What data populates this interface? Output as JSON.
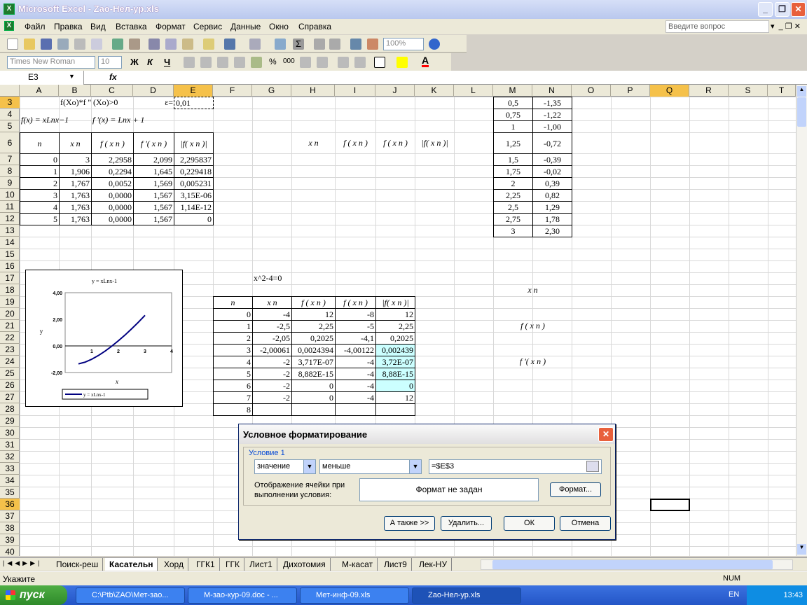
{
  "app": {
    "title": "Microsoft Excel - Zao-Нел-ур.xls",
    "icon": "excel-icon"
  },
  "menu": [
    "Файл",
    "Правка",
    "Вид",
    "Вставка",
    "Формат",
    "Сервис",
    "Данные",
    "Окно",
    "Справка"
  ],
  "ask_placeholder": "Введите вопрос",
  "toolbar": {
    "zoom": "100%",
    "font": "Times New Roman",
    "size": "10",
    "bold": "Ж",
    "italic": "К",
    "underline": "Ч",
    "percent": "%",
    "thousands": "000"
  },
  "namebox": "E3",
  "fx": "fx",
  "columns": [
    "A",
    "B",
    "C",
    "D",
    "E",
    "F",
    "G",
    "H",
    "I",
    "J",
    "K",
    "L",
    "M",
    "N",
    "O",
    "P",
    "Q",
    "R",
    "S",
    "T"
  ],
  "rows": [
    "3",
    "4",
    "5",
    "6",
    "7",
    "8",
    "9",
    "10",
    "11",
    "12",
    "13",
    "14",
    "15",
    "16",
    "17",
    "18",
    "19",
    "20",
    "21",
    "22",
    "23",
    "24",
    "25",
    "26",
    "27",
    "28",
    "29",
    "30",
    "31",
    "32",
    "33",
    "34",
    "35",
    "36",
    "37",
    "38",
    "39",
    "40"
  ],
  "cells": {
    "cond": "f(Xo)*f '' (Xo)>0",
    "eps_label": "ε=",
    "eps": "0,01",
    "f1": "f(x) = xLnx−1",
    "f2": "f '(x) = Lnx + 1",
    "h_n": "n",
    "h_x": "x n",
    "h_f": "f ( x n )",
    "h_fp": "f '( x n )",
    "h_abs": "|f( x n )|",
    "tbl1": [
      [
        "0",
        "3",
        "2,2958",
        "2,099",
        "2,295837"
      ],
      [
        "1",
        "1,906",
        "0,2294",
        "1,645",
        "0,229418"
      ],
      [
        "2",
        "1,767",
        "0,0052",
        "1,569",
        "0,005231"
      ],
      [
        "3",
        "1,763",
        "0,0000",
        "1,567",
        "3,15E-06"
      ],
      [
        "4",
        "1,763",
        "0,0000",
        "1,567",
        "1,14E-12"
      ],
      [
        "5",
        "1,763",
        "0,0000",
        "1,567",
        "0"
      ]
    ],
    "mn": [
      [
        "0,5",
        "-1,35"
      ],
      [
        "0,75",
        "-1,22"
      ],
      [
        "1",
        "-1,00"
      ],
      [
        "1,25",
        "-0,72"
      ],
      [
        "1,5",
        "-0,39"
      ],
      [
        "1,75",
        "-0,02"
      ],
      [
        "2",
        "0,39"
      ],
      [
        "2,25",
        "0,82"
      ],
      [
        "2,5",
        "1,29"
      ],
      [
        "2,75",
        "1,78"
      ],
      [
        "3",
        "2,30"
      ]
    ],
    "eq2": "x^2-4=0",
    "tbl2": [
      [
        "0",
        "-4",
        "12",
        "-8",
        "12"
      ],
      [
        "1",
        "-2,5",
        "2,25",
        "-5",
        "2,25"
      ],
      [
        "2",
        "-2,05",
        "0,2025",
        "-4,1",
        "0,2025"
      ],
      [
        "3",
        "-2,00061",
        "0,0024394",
        "-4,00122",
        "0,002439"
      ],
      [
        "4",
        "-2",
        "3,717E-07",
        "-4",
        "3,72E-07"
      ],
      [
        "5",
        "-2",
        "8,882E-15",
        "-4",
        "8,88E-15"
      ],
      [
        "6",
        "-2",
        "0",
        "-4",
        "0"
      ],
      [
        "7",
        "-2",
        "0",
        "-4",
        "12"
      ],
      [
        "8",
        "",
        "",
        "",
        ""
      ]
    ],
    "side_x": "x n",
    "side_f": "f ( x n )",
    "side_fp": "f '( x n )"
  },
  "chart_data": {
    "type": "line",
    "title": "y = xLnx-1",
    "xlabel": "x",
    "ylabel": "y",
    "yticks": [
      "4,00",
      "2,00",
      "0,00",
      "-2,00"
    ],
    "xticks": [
      "1",
      "2",
      "3",
      "4"
    ],
    "ylim": [
      -2,
      4
    ],
    "xlim": [
      0,
      4
    ],
    "series": [
      {
        "name": "y = xLnx-1",
        "x": [
          0.5,
          0.75,
          1,
          1.25,
          1.5,
          1.75,
          2,
          2.25,
          2.5,
          2.75,
          3
        ],
        "y": [
          -1.35,
          -1.22,
          -1.0,
          -0.72,
          -0.39,
          -0.02,
          0.39,
          0.82,
          1.29,
          1.78,
          2.3
        ]
      }
    ]
  },
  "dialog": {
    "title": "Условное форматирование",
    "cond_label": "Условие 1",
    "op1": "значение",
    "op2": "меньше",
    "formula": "=$E$3",
    "display_label": "Отображение ячейки при выполнении условия:",
    "preview": "Формат не задан",
    "format_btn": "Формат...",
    "also_btn": "А также >>",
    "delete_btn": "Удалить...",
    "ok_btn": "ОК",
    "cancel_btn": "Отмена"
  },
  "sheets": [
    "Поиск-реш",
    "Касательн",
    "Хорд",
    "ГГК1",
    "ГГК",
    "Лист1",
    "Дихотомия",
    "М-касат",
    "Лист9",
    "Лек-НУ"
  ],
  "status": {
    "left": "Укажите",
    "num": "NUM"
  },
  "taskbar": {
    "start": "пуск",
    "tasks": [
      "C:\\Ptb\\ZAO\\Мет-зао...",
      "М-зао-кур-09.doc - ...",
      "Мет-инф-09.xls",
      "Zao-Нел-ур.xls"
    ],
    "lang": "EN",
    "time": "13:43"
  }
}
